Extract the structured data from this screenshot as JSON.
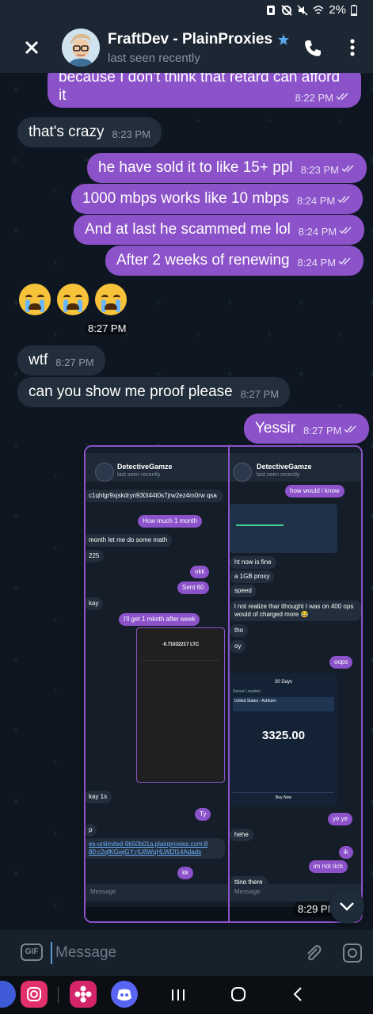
{
  "status": {
    "battery": "2%"
  },
  "header": {
    "title": "FraftDev - PlainProxies",
    "subtitle": "last seen recently"
  },
  "messages": [
    {
      "dir": "out",
      "text": "because I don't think that retard can afford",
      "text2": "it",
      "time": "8:22 PM"
    },
    {
      "dir": "in",
      "text": "that's crazy",
      "time": "8:23 PM"
    },
    {
      "dir": "out",
      "text": "he have sold it to like 15+ ppl",
      "time": "8:23 PM"
    },
    {
      "dir": "out",
      "text": "1000 mbps works like 10 mbps",
      "time": "8:24 PM"
    },
    {
      "dir": "out",
      "text": "And at last he scammed me lol",
      "time": "8:24 PM"
    },
    {
      "dir": "out",
      "text": "After 2 weeks of renewing",
      "time": "8:24 PM"
    },
    {
      "dir": "in",
      "text": "😭😭😭",
      "time": "8:27 PM"
    },
    {
      "dir": "in",
      "text": "wtf",
      "time": "8:27 PM"
    },
    {
      "dir": "in",
      "text": "can you show me proof please",
      "time": "8:27 PM"
    },
    {
      "dir": "out",
      "text": "Yessir",
      "time": "8:27 PM"
    }
  ],
  "screenshot": {
    "time": "8:29 PM",
    "left": {
      "title": "DetectiveGamze",
      "subtitle": "last seen recently",
      "msgs": [
        "c1qhlgr9xjskdryn930t44t0s7jrw2ez4m0rw qsa",
        "How much 1 month",
        "month let me do some math",
        "225",
        "okk",
        "Sent 60",
        "kay",
        "I'll get 1 mknth after week",
        "kay 1s",
        "Ty",
        "p",
        "es-unlimited-9b50b01a.plainproxies.com:8 80:c2qfKGwjGY:rlU8WqHLWDI14Adads",
        "kk"
      ],
      "amount": "-0.71032217 LTC",
      "input_placeholder": "Message"
    },
    "right": {
      "title": "DetectiveGamze",
      "subtitle": "last seen recently",
      "msgs": [
        "how would i know",
        "ht now is fine",
        "a 1GB proxy",
        "speed",
        "l not realize thar  ithought I was on 400 ops would of charged more 😂",
        "tho",
        "oy",
        "oops",
        "ye ye",
        "hehe",
        "ik",
        "im not rich",
        "tting there"
      ],
      "plan": "30 Days",
      "location_label": "Server Location",
      "location": "United States - Ashburn",
      "price": "3325.00",
      "buy": "Buy Now",
      "input_placeholder": "Message"
    }
  },
  "input": {
    "placeholder": "Message",
    "gif": "GIF"
  },
  "colors": {
    "outgoing": "#8b52c9",
    "incoming": "#222e3b",
    "background": "#0e1621",
    "accent": "#5b9bd5"
  }
}
